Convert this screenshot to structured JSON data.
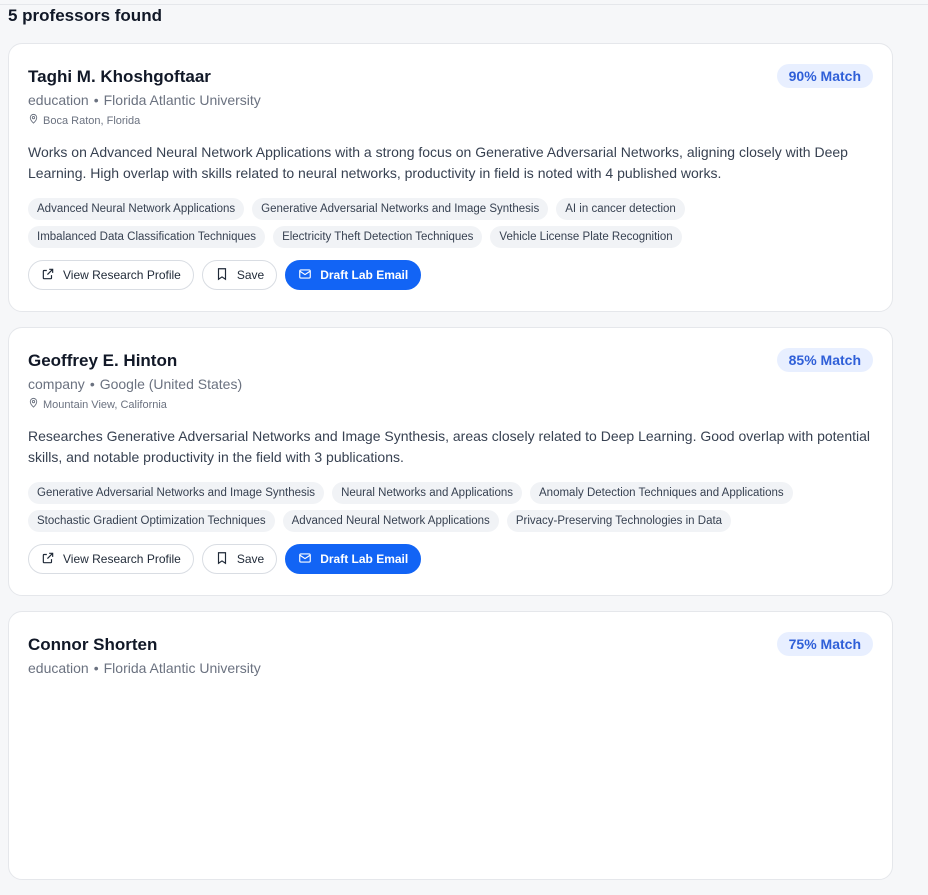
{
  "header": {
    "count_label": "5 professors found"
  },
  "colors": {
    "accent": "#1264f5",
    "badge_bg": "#e8efff",
    "badge_text": "#2f5fd8"
  },
  "actions": {
    "view_profile": "View Research Profile",
    "save": "Save",
    "draft_email": "Draft Lab Email"
  },
  "professors": [
    {
      "name": "Taghi M. Khoshgoftaar",
      "match": "90% Match",
      "sector": "education",
      "institution": "Florida Atlantic University",
      "location": "Boca Raton, Florida",
      "summary": "Works on Advanced Neural Network Applications with a strong focus on Generative Adversarial Networks, aligning closely with Deep Learning. High overlap with skills related to neural networks, productivity in field is noted with 4 published works.",
      "tags": [
        "Advanced Neural Network Applications",
        "Generative Adversarial Networks and Image Synthesis",
        "AI in cancer detection",
        "Imbalanced Data Classification Techniques",
        "Electricity Theft Detection Techniques",
        "Vehicle License Plate Recognition"
      ]
    },
    {
      "name": "Geoffrey E. Hinton",
      "match": "85% Match",
      "sector": "company",
      "institution": "Google (United States)",
      "location": "Mountain View, California",
      "summary": "Researches Generative Adversarial Networks and Image Synthesis, areas closely related to Deep Learning. Good overlap with potential skills, and notable productivity in the field with 3 publications.",
      "tags": [
        "Generative Adversarial Networks and Image Synthesis",
        "Neural Networks and Applications",
        "Anomaly Detection Techniques and Applications",
        "Stochastic Gradient Optimization Techniques",
        "Advanced Neural Network Applications",
        "Privacy-Preserving Technologies in Data"
      ]
    },
    {
      "name": "Connor Shorten",
      "match": "75% Match",
      "sector": "education",
      "institution": "Florida Atlantic University"
    }
  ]
}
